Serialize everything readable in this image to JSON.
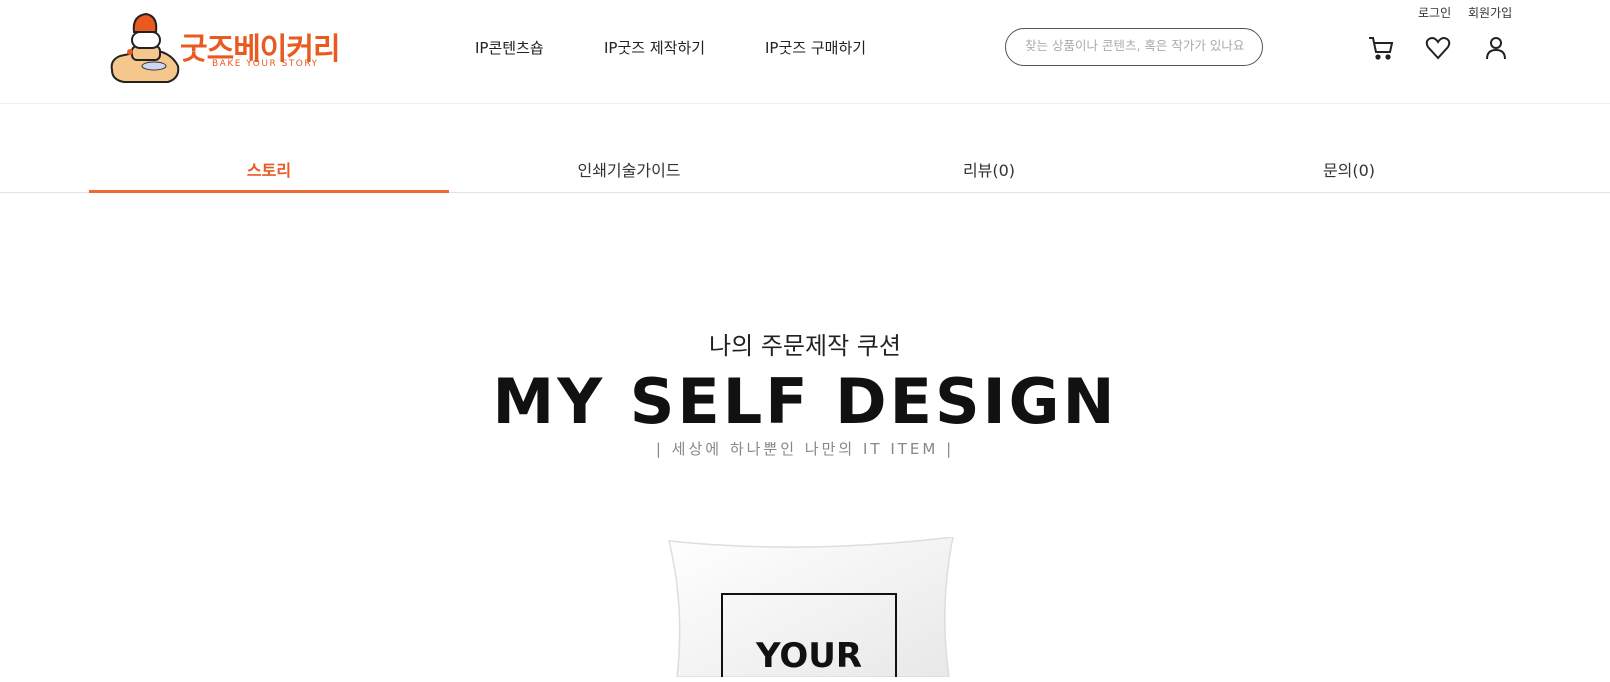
{
  "util": {
    "login": "로그인",
    "join": "회원가입"
  },
  "logo": {
    "name": "굿즈베이커리",
    "tagline": "BAKE YOUR STORY"
  },
  "nav": {
    "items": [
      {
        "label": "IP콘텐츠숍"
      },
      {
        "label": "IP굿즈 제작하기"
      },
      {
        "label": "IP굿즈 구매하기"
      }
    ]
  },
  "search": {
    "placeholder": "찾는 상품이나 콘텐츠, 혹은 작가가 있나요?"
  },
  "icons": [
    "cart-icon",
    "heart-icon",
    "user-icon"
  ],
  "tabs": [
    {
      "label": "스토리",
      "active": true
    },
    {
      "label": "인쇄기술가이드"
    },
    {
      "label": "리뷰(0)"
    },
    {
      "label": "문의(0)"
    }
  ],
  "hero": {
    "subtitle": "나의 주문제작 쿠션",
    "title": "MY SELF DESIGN",
    "tagline": "| 세상에 하나뿐인 나만의 IT ITEM |"
  },
  "product": {
    "label": "YOUR"
  },
  "colors": {
    "accent": "#e85a20"
  }
}
